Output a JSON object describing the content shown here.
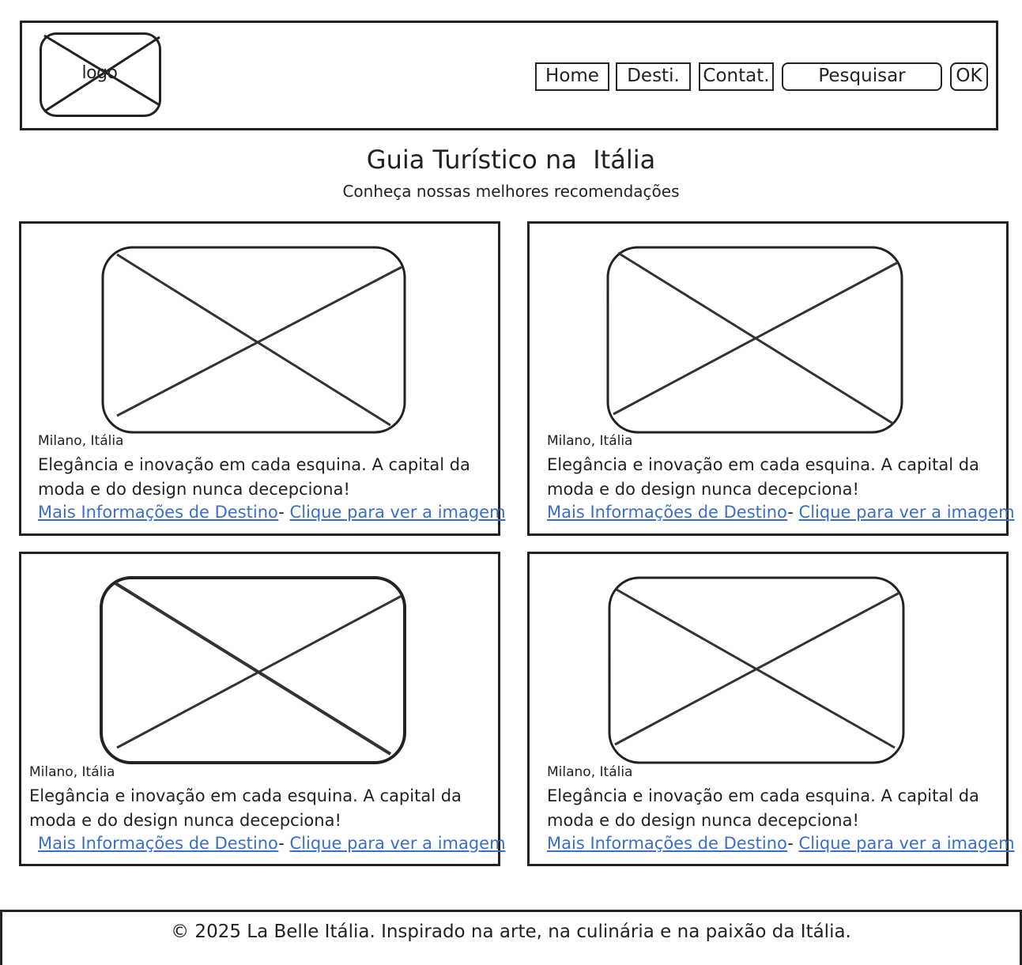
{
  "header": {
    "logo": "logo",
    "nav": {
      "home": "Home",
      "destinations": "Desti.",
      "contact": "Contat."
    },
    "search_placeholder": "Pesquisar",
    "ok": "OK"
  },
  "main": {
    "title": "Guia Turístico na  Itália",
    "subtitle": "Conheça nossas melhores recomendações"
  },
  "cards": [
    {
      "location": "Milano, Itália",
      "description": "Elegância e inovação em cada esquina. A capital da moda e do design nunca decepciona!",
      "link_info": "Mais Informações de Destino",
      "separator": "-",
      "link_image": "Clique para ver a imagem"
    },
    {
      "location": "Milano, Itália",
      "description": "Elegância e inovação em cada esquina. A capital da moda e do design nunca decepciona!",
      "link_info": "Mais Informações de Destino",
      "separator": "-",
      "link_image": "Clique para ver a imagem"
    },
    {
      "location": "Milano, Itália",
      "description": "Elegância e inovação em cada esquina. A capital da moda e do design nunca decepciona!",
      "link_info": "Mais Informações de Destino",
      "separator": "-",
      "link_image": "Clique para ver a imagem"
    },
    {
      "location": "Milano, Itália",
      "description": "Elegância e inovação em cada esquina. A capital da moda e do design nunca decepciona!",
      "link_info": "Mais Informações de Destino",
      "separator": "-",
      "link_image": "Clique para ver a imagem"
    }
  ],
  "footer": {
    "text": "© 2025 La Belle Itália. Inspirado na arte, na culinária e na paixão da Itália."
  },
  "colors": {
    "stroke": "#222222",
    "link": "#3a6fc4"
  }
}
